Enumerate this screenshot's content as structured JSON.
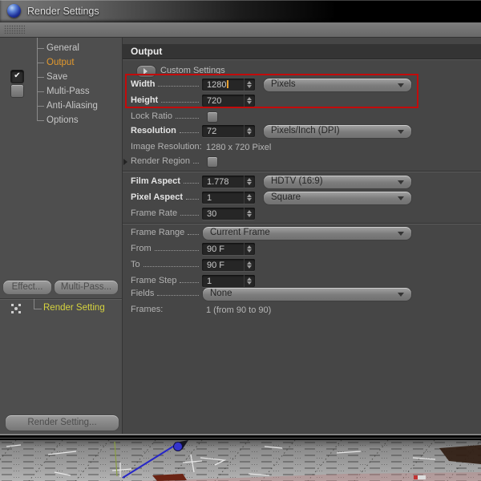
{
  "titlebar": {
    "title": "Render Settings"
  },
  "sidebar": {
    "tree": [
      {
        "label": "General"
      },
      {
        "label": "Output"
      },
      {
        "label": "Save"
      },
      {
        "label": "Multi-Pass"
      },
      {
        "label": "Anti-Aliasing"
      },
      {
        "label": "Options"
      }
    ],
    "save_enabled_checked": true,
    "multipass_enabled_checked": false,
    "buttons": {
      "effect": "Effect...",
      "multipass": "Multi-Pass...",
      "render_setting": "Render Setting..."
    },
    "active_setting": {
      "label": "Render Setting"
    }
  },
  "panel": {
    "header": "Output",
    "custom_settings_label": "Custom Settings",
    "rows": {
      "width": {
        "label": "Width",
        "value": "1280",
        "unit": "Pixels"
      },
      "height": {
        "label": "Height",
        "value": "720"
      },
      "lock_ratio": {
        "label": "Lock Ratio",
        "checked": false
      },
      "resolution": {
        "label": "Resolution",
        "value": "72",
        "unit": "Pixels/Inch (DPI)"
      },
      "image_resolution": {
        "label": "Image Resolution:",
        "value": "1280 x 720 Pixel"
      },
      "render_region": {
        "label": "Render Region",
        "checked": false
      },
      "film_aspect": {
        "label": "Film Aspect",
        "value": "1.778",
        "unit": "HDTV (16:9)"
      },
      "pixel_aspect": {
        "label": "Pixel Aspect",
        "value": "1",
        "unit": "Square"
      },
      "frame_rate": {
        "label": "Frame Rate",
        "value": "30"
      },
      "frame_range": {
        "label": "Frame Range",
        "value": "Current Frame"
      },
      "from": {
        "label": "From",
        "value": "90 F"
      },
      "to": {
        "label": "To",
        "value": "90 F"
      },
      "frame_step": {
        "label": "Frame Step",
        "value": "1"
      },
      "fields": {
        "label": "Fields",
        "value": "None"
      },
      "frames": {
        "label": "Frames:",
        "value": "1 (from 90 to 90)"
      }
    }
  },
  "icons": {
    "checkmark": "✔"
  },
  "colors": {
    "selected_tree_item": "#e2992e",
    "active_setting_label": "#d6d33e",
    "highlight_box": "#c30b0b",
    "value_cursor": "#e8a030"
  }
}
